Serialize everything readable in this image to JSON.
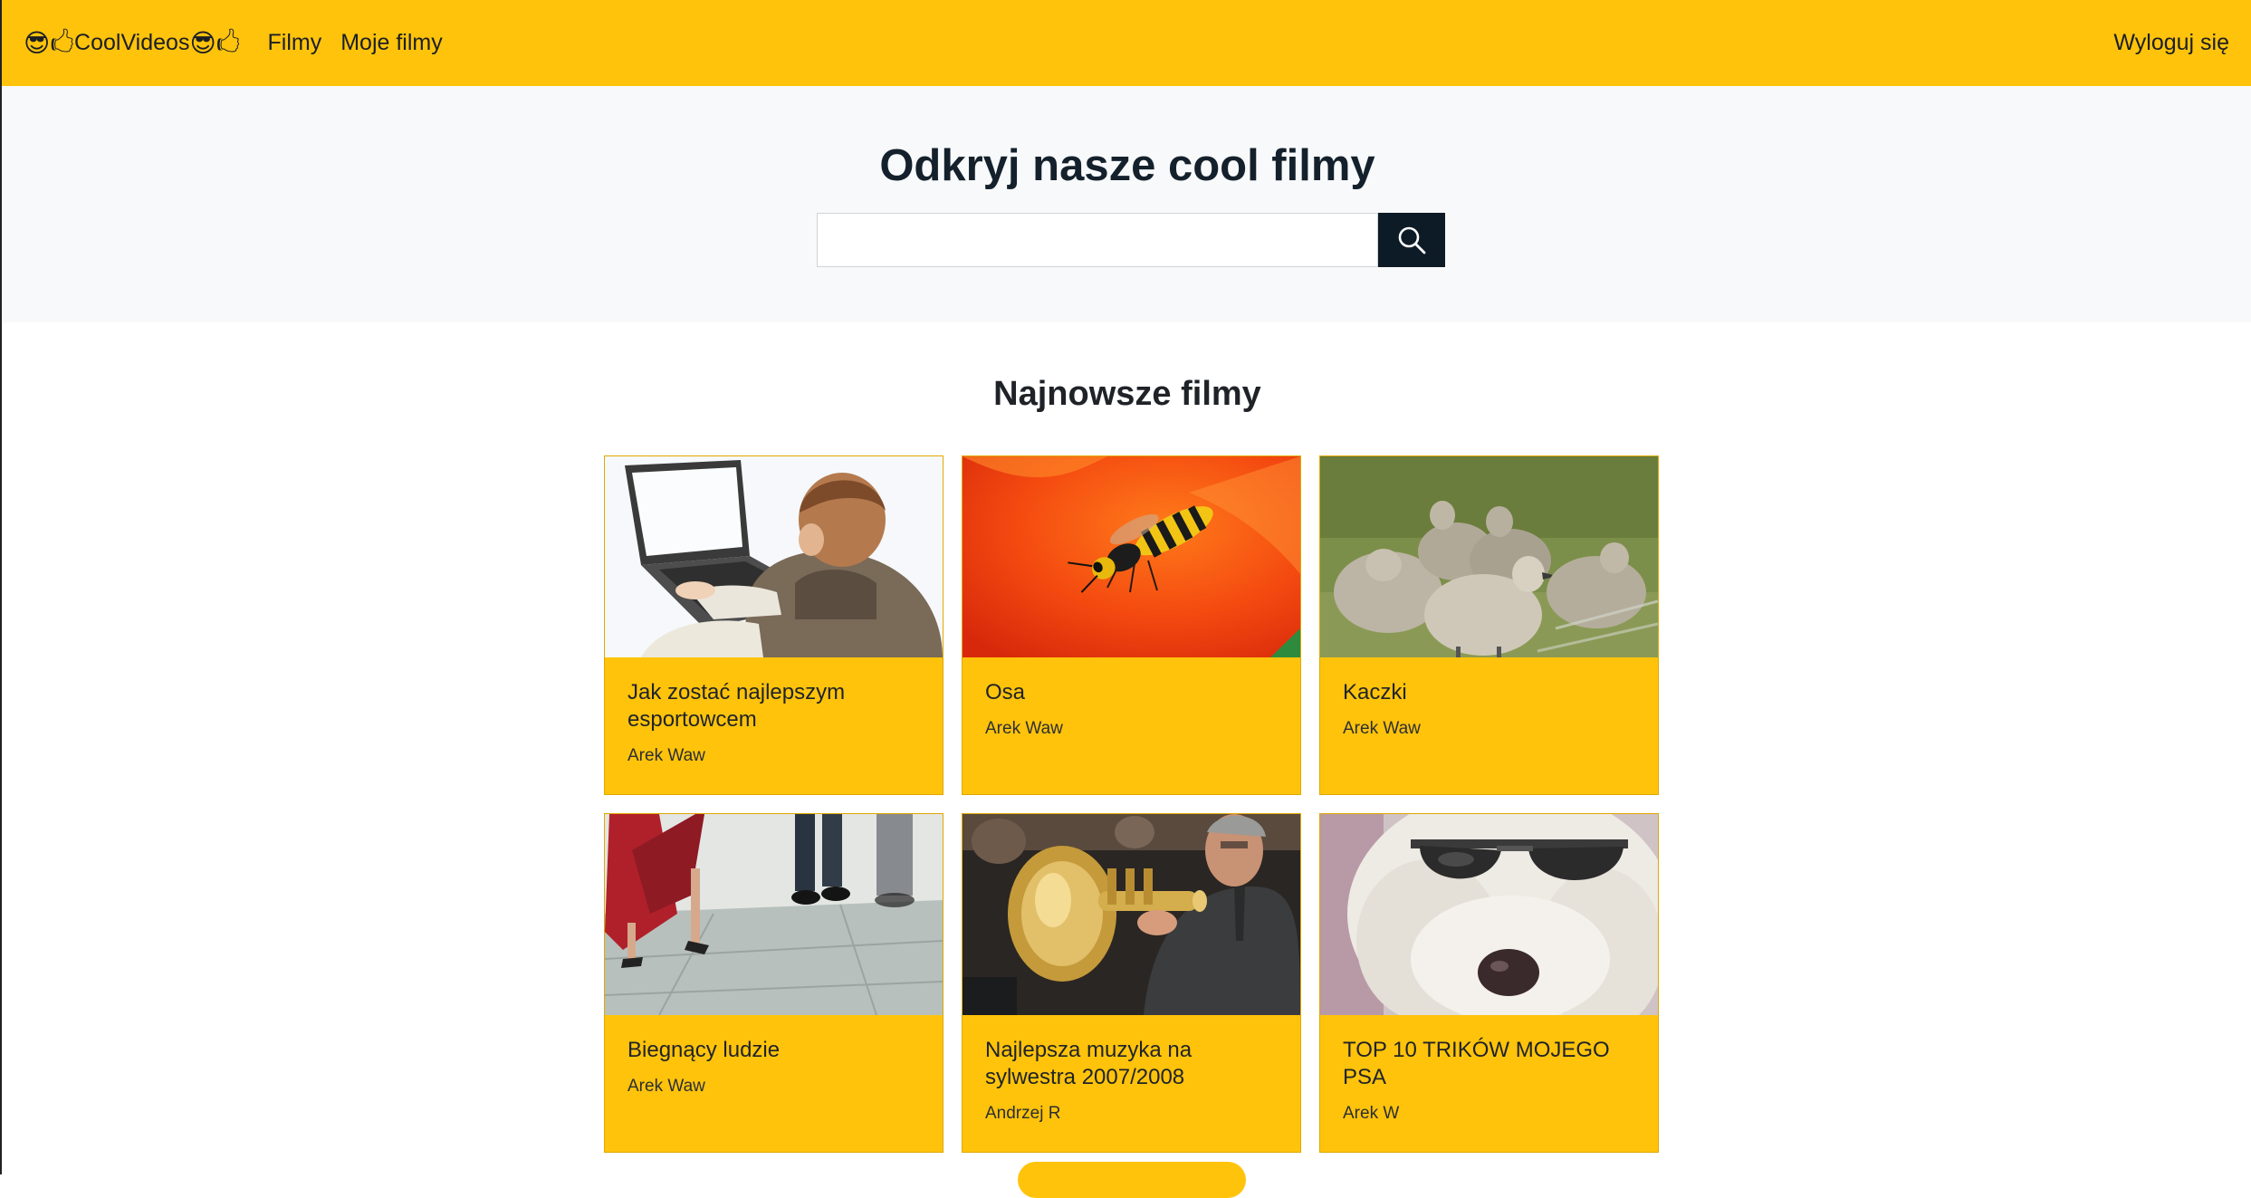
{
  "navbar": {
    "brand_prefix_emoji": "😎🖒",
    "brand_text": "CoolVideos",
    "brand_suffix_emoji": "😎🖒",
    "links": [
      "Filmy",
      "Moje filmy"
    ],
    "logout": "Wyloguj się",
    "bg_color": "#ffc30b"
  },
  "hero": {
    "title": "Odkryj nasze cool filmy",
    "search": {
      "value": "",
      "placeholder": ""
    },
    "search_icon": "search-icon"
  },
  "latest": {
    "title": "Najnowsze filmy",
    "videos": [
      {
        "title": "Jak zostać najlepszym esportowcem",
        "author": "Arek Waw",
        "thumbnail": "boy-at-laptop"
      },
      {
        "title": "Osa",
        "author": "Arek Waw",
        "thumbnail": "wasp-on-red-petal"
      },
      {
        "title": "Kaczki",
        "author": "Arek Waw",
        "thumbnail": "goslings-on-grass"
      },
      {
        "title": "Biegnący ludzie",
        "author": "Arek Waw",
        "thumbnail": "people-walking-legs"
      },
      {
        "title": "Najlepsza muzyka na sylwestra 2007/2008",
        "author": "Andrzej R",
        "thumbnail": "man-playing-tuba"
      },
      {
        "title": "TOP 10 TRIKÓW MOJEGO PSA",
        "author": "Arek W",
        "thumbnail": "dog-with-sunglasses"
      }
    ]
  },
  "colors": {
    "accent": "#ffc30b",
    "dark": "#0d1b27",
    "hero_bg": "#f8f9fa"
  }
}
